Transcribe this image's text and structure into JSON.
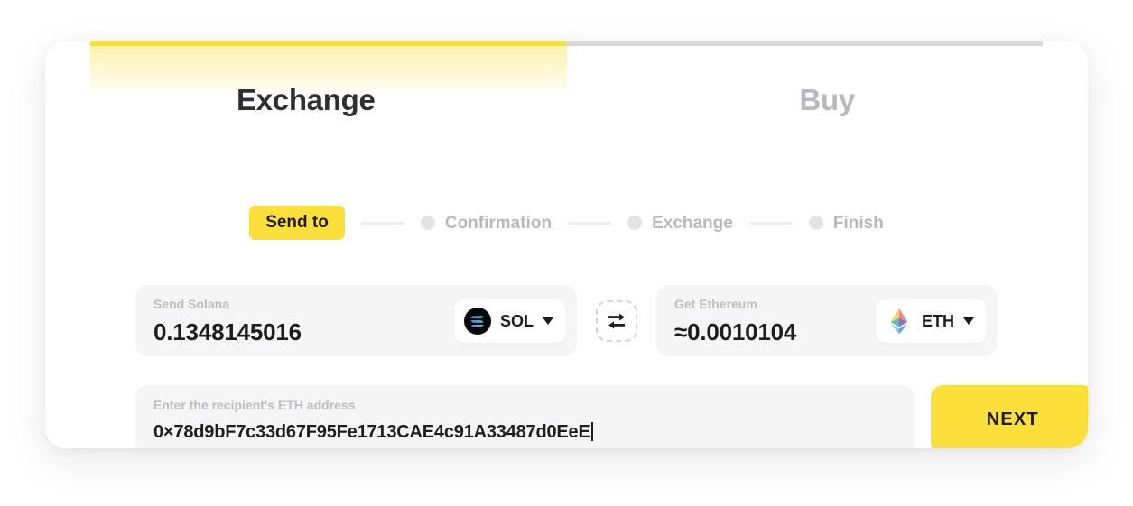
{
  "tabs": [
    {
      "label": "Exchange",
      "state": "active",
      "indicator_color": "#fcdf3a"
    },
    {
      "label": "Buy",
      "state": "inactive",
      "indicator_color": "#d9d9d9"
    }
  ],
  "stepper": {
    "steps": [
      {
        "label": "Send to",
        "state": "active"
      },
      {
        "label": "Confirmation",
        "state": "pending"
      },
      {
        "label": "Exchange",
        "state": "pending"
      },
      {
        "label": "Finish",
        "state": "pending"
      }
    ],
    "active_color": "#fcdf3a",
    "pending_color": "#b9b9bd"
  },
  "exchange": {
    "send": {
      "label": "Send Solana",
      "amount": "0.1348145016",
      "coin": {
        "ticker": "SOL",
        "icon": "solana-icon"
      }
    },
    "get": {
      "label": "Get Ethereum",
      "amount": "≈0.0010104",
      "coin": {
        "ticker": "ETH",
        "icon": "ethereum-icon"
      }
    },
    "swap_icon": "swap-arrows-icon"
  },
  "address": {
    "label": "Enter the recipient's ETH address",
    "value": "0×78d9bF7c33d67F95Fe1713CAE4c91A33487d0EeE",
    "placeholder": "Enter the recipient's ETH address"
  },
  "actions": {
    "next_label": "NEXT",
    "next_color": "#fcdf3a"
  }
}
